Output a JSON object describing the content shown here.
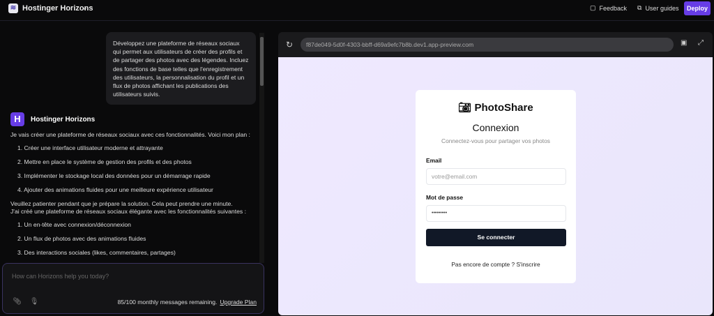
{
  "header": {
    "app_name": "Hostinger Horizons",
    "feedback": "Feedback",
    "user_guides": "User guides",
    "deploy": "Deploy"
  },
  "chat": {
    "user_message": "Développez une plateforme de réseaux sociaux qui permet aux utilisateurs de créer des profils et de partager des photos avec des légendes. Incluez des fonctions de base telles que l'enregistrement des utilisateurs, la personnalisation du profil et un flux de photos affichant les publications des utilisateurs suivis.",
    "assistant_name": "Hostinger Horizons",
    "intro": "Je vais créer une plateforme de réseaux sociaux avec ces fonctionnalités. Voici mon plan :",
    "plan": [
      "1. Créer une interface utilisateur moderne et attrayante",
      "2. Mettre en place le système de gestion des profils et des photos",
      "3. Implémenter le stockage local des données pour un démarrage rapide",
      "4. Ajouter des animations fluides pour une meilleure expérience utilisateur"
    ],
    "wait": "Veuillez patienter pendant que je prépare la solution. Cela peut prendre une minute.",
    "done": "J'ai créé une plateforme de réseaux sociaux élégante avec les fonctionnalités suivantes :",
    "features": [
      "1. Un en-tête avec connexion/déconnexion",
      "2. Un flux de photos avec des animations fluides",
      "3. Des interactions sociales (likes, commentaires, partages)"
    ],
    "input_placeholder": "How can Horizons help you today?",
    "remaining": "85/100 monthly messages remaining.",
    "upgrade": "Upgrade Plan"
  },
  "preview": {
    "url": "f87de049-5d0f-4303-bbff-d69a9efc7b8b.dev1.app-preview.com",
    "app_name": "PhotoShare",
    "title": "Connexion",
    "subtitle": "Connectez-vous pour partager vos photos",
    "email_label": "Email",
    "email_placeholder": "votre@email.com",
    "password_label": "Mot de passe",
    "password_value": "•••••••••",
    "submit": "Se connecter",
    "signup": "Pas encore de compte ? S'inscrire"
  }
}
